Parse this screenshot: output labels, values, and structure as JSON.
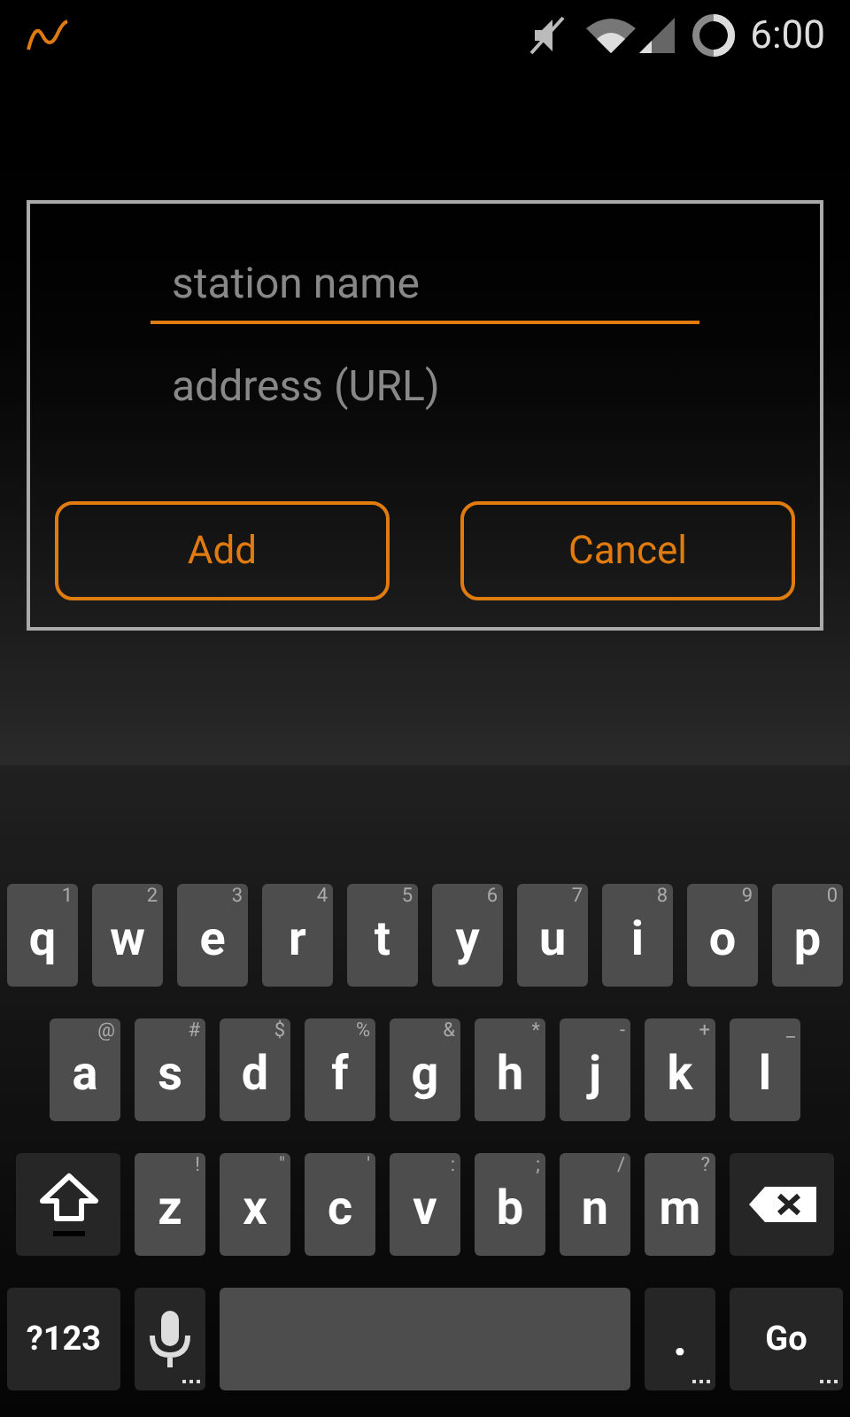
{
  "status_bar": {
    "time": "6:00"
  },
  "dialog": {
    "fields": [
      {
        "placeholder": "station name",
        "focused": true
      },
      {
        "placeholder": "address (URL)",
        "focused": false
      }
    ],
    "buttons": [
      "Add",
      "Cancel"
    ]
  },
  "keyboard": {
    "rows": [
      {
        "keys": [
          {
            "kind": "letter",
            "label": "q",
            "hint": "1"
          },
          {
            "kind": "letter",
            "label": "w",
            "hint": "2"
          },
          {
            "kind": "letter",
            "label": "e",
            "hint": "3"
          },
          {
            "kind": "letter",
            "label": "r",
            "hint": "4"
          },
          {
            "kind": "letter",
            "label": "t",
            "hint": "5"
          },
          {
            "kind": "letter",
            "label": "y",
            "hint": "6"
          },
          {
            "kind": "letter",
            "label": "u",
            "hint": "7"
          },
          {
            "kind": "letter",
            "label": "i",
            "hint": "8"
          },
          {
            "kind": "letter",
            "label": "o",
            "hint": "9"
          },
          {
            "kind": "letter",
            "label": "p",
            "hint": "0"
          }
        ]
      },
      {
        "keys": [
          {
            "kind": "letter",
            "label": "a",
            "hint": "@"
          },
          {
            "kind": "letter",
            "label": "s",
            "hint": "#"
          },
          {
            "kind": "letter",
            "label": "d",
            "hint": "$"
          },
          {
            "kind": "letter",
            "label": "f",
            "hint": "%"
          },
          {
            "kind": "letter",
            "label": "g",
            "hint": "&"
          },
          {
            "kind": "letter",
            "label": "h",
            "hint": "*"
          },
          {
            "kind": "letter",
            "label": "j",
            "hint": "-"
          },
          {
            "kind": "letter",
            "label": "k",
            "hint": "+"
          },
          {
            "kind": "letter",
            "label": "l",
            "hint": "_"
          }
        ]
      },
      {
        "keys": [
          {
            "kind": "shift"
          },
          {
            "kind": "letter",
            "label": "z",
            "hint": "!"
          },
          {
            "kind": "letter",
            "label": "x",
            "hint": "\""
          },
          {
            "kind": "letter",
            "label": "c",
            "hint": "'"
          },
          {
            "kind": "letter",
            "label": "v",
            "hint": ":"
          },
          {
            "kind": "letter",
            "label": "b",
            "hint": ";"
          },
          {
            "kind": "letter",
            "label": "n",
            "hint": "/"
          },
          {
            "kind": "letter",
            "label": "m",
            "hint": "?"
          },
          {
            "kind": "backspace"
          }
        ]
      }
    ],
    "bottom_row": [
      {
        "kind": "symbols",
        "label": "?123"
      },
      {
        "kind": "mic"
      },
      {
        "kind": "space"
      },
      {
        "kind": "period",
        "label": "."
      },
      {
        "kind": "go",
        "label": "Go"
      }
    ]
  }
}
